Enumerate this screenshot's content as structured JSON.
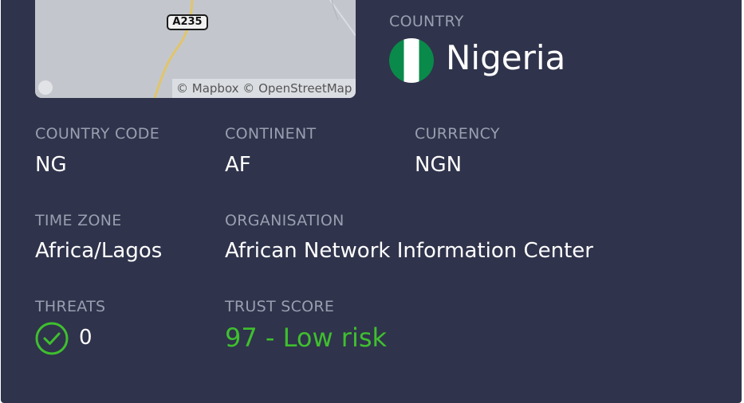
{
  "map": {
    "road_label": "A235",
    "attribution": "© Mapbox © OpenStreetMap"
  },
  "country": {
    "label": "COUNTRY",
    "name": "Nigeria",
    "flag_colors": [
      "#0a8a4a",
      "#ffffff",
      "#0a8a4a"
    ]
  },
  "fields": {
    "country_code": {
      "label": "COUNTRY CODE",
      "value": "NG"
    },
    "continent": {
      "label": "CONTINENT",
      "value": "AF"
    },
    "currency": {
      "label": "CURRENCY",
      "value": "NGN"
    },
    "time_zone": {
      "label": "TIME ZONE",
      "value": "Africa/Lagos"
    },
    "organisation": {
      "label": "ORGANISATION",
      "value": "African Network Information Center"
    },
    "threats": {
      "label": "THREATS",
      "value": "0",
      "icon": "check-circle-icon"
    },
    "trust_score": {
      "label": "TRUST SCORE",
      "value": "97 - Low risk",
      "color": "#3fbf2f"
    }
  },
  "colors": {
    "background": "#2f334b",
    "label": "#9a9eb0",
    "value": "#ffffff",
    "success": "#3fbf2f"
  }
}
